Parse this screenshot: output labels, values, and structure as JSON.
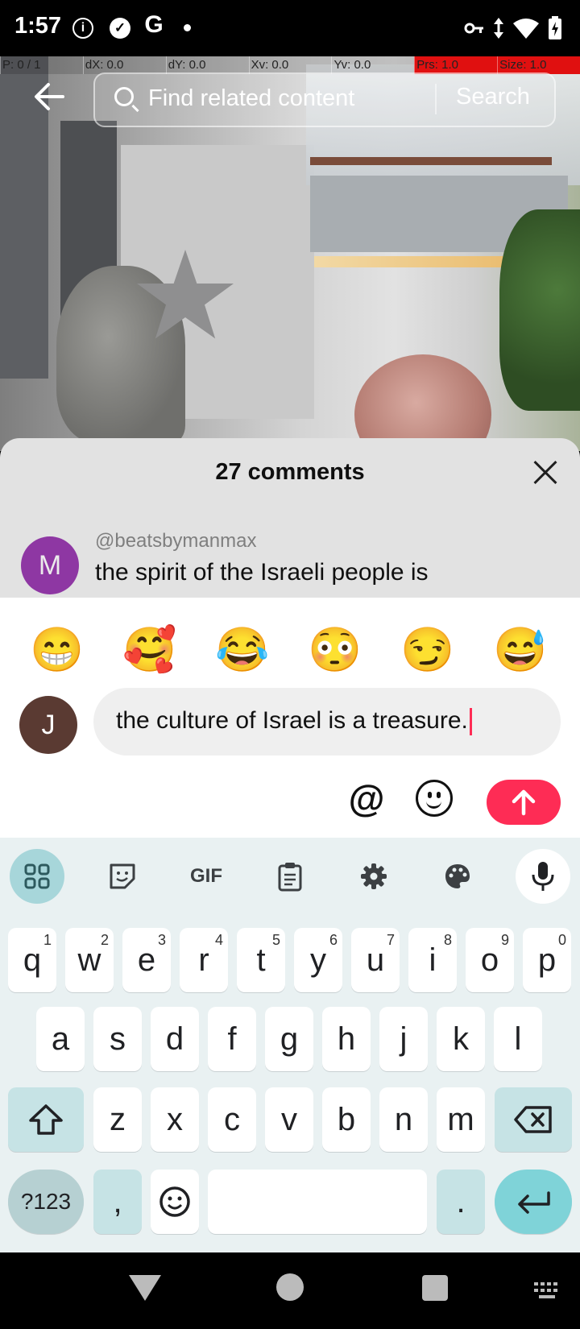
{
  "status_bar": {
    "time": "1:57",
    "icons": [
      "info-icon",
      "check-circle-icon",
      "google-icon",
      "dot-icon",
      "vpn-key-icon",
      "data-arrows-icon",
      "wifi-icon",
      "battery-charging-icon"
    ]
  },
  "pointer_overlay": {
    "p": "P: 0 / 1",
    "dx": "dX: 0.0",
    "dy": "dY: 0.0",
    "xv": "Xv: 0.0",
    "yv": "Yv: 0.0",
    "prs": "Prs: 1.0",
    "size": "Size: 1.0"
  },
  "top_bar": {
    "search_placeholder": "Find related content",
    "search_button": "Search"
  },
  "comments": {
    "title": "27 comments",
    "items": [
      {
        "avatar_letter": "M",
        "avatar_color": "#9b3cb1",
        "username": "@beatsbymanmax",
        "text": "the spirit of the Israeli people is"
      }
    ]
  },
  "composer": {
    "emojis": [
      "😁",
      "🥰",
      "😂",
      "😳",
      "😏",
      "😅"
    ],
    "avatar_letter": "J",
    "avatar_color": "#5a3a32",
    "input_value": "the culture of Israel is a treasure.",
    "mention_symbol": "@",
    "send_color": "#fe2c55"
  },
  "keyboard": {
    "toolbar": [
      "apps-grid-icon",
      "sticker-icon",
      "GIF",
      "clipboard-icon",
      "settings-gear-icon",
      "palette-icon",
      "microphone-icon"
    ],
    "gif_label": "GIF",
    "row1": [
      {
        "k": "q",
        "n": "1"
      },
      {
        "k": "w",
        "n": "2"
      },
      {
        "k": "e",
        "n": "3"
      },
      {
        "k": "r",
        "n": "4"
      },
      {
        "k": "t",
        "n": "5"
      },
      {
        "k": "y",
        "n": "6"
      },
      {
        "k": "u",
        "n": "7"
      },
      {
        "k": "i",
        "n": "8"
      },
      {
        "k": "o",
        "n": "9"
      },
      {
        "k": "p",
        "n": "0"
      }
    ],
    "row2": [
      "a",
      "s",
      "d",
      "f",
      "g",
      "h",
      "j",
      "k",
      "l"
    ],
    "row3": [
      "z",
      "x",
      "c",
      "v",
      "b",
      "n",
      "m"
    ],
    "symbols_label": "?123",
    "comma": ",",
    "period": "."
  },
  "nav_bar": {
    "icons": [
      "back-triangle-icon",
      "home-circle-icon",
      "recents-square-icon",
      "keyboard-switch-icon"
    ]
  }
}
